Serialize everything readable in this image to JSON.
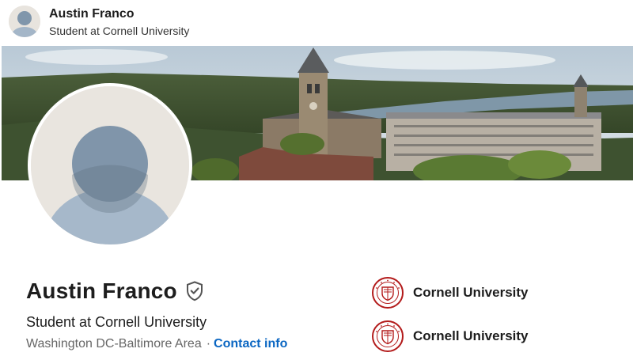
{
  "top_bar": {
    "name": "Austin Franco",
    "headline": "Student at Cornell University"
  },
  "profile": {
    "name": "Austin Franco",
    "headline": "Student at Cornell University",
    "location": "Washington DC-Baltimore Area",
    "separator": "·",
    "contact_label": "Contact info"
  },
  "education": [
    {
      "label": "Cornell University",
      "icon": "cornell-seal-icon"
    },
    {
      "label": "Cornell University",
      "icon": "cornell-seal-icon"
    }
  ],
  "colors": {
    "link": "#0a66c2",
    "seal": "#b31b1b",
    "avatar_bg": "#e9e5df",
    "avatar_figure": "#8fa3b7"
  }
}
